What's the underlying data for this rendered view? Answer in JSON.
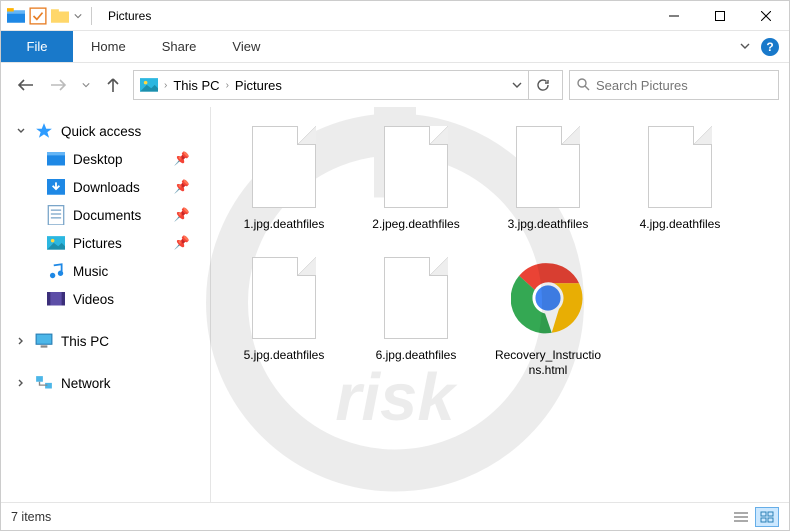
{
  "window": {
    "title": "Pictures"
  },
  "ribbon": {
    "file": "File",
    "tabs": [
      "Home",
      "Share",
      "View"
    ]
  },
  "address": {
    "crumbs": [
      "This PC",
      "Pictures"
    ]
  },
  "search": {
    "placeholder": "Search Pictures"
  },
  "sidebar": {
    "quick_access": "Quick access",
    "items": [
      {
        "label": "Desktop",
        "pinned": true,
        "icon": "desktop"
      },
      {
        "label": "Downloads",
        "pinned": true,
        "icon": "downloads"
      },
      {
        "label": "Documents",
        "pinned": true,
        "icon": "documents"
      },
      {
        "label": "Pictures",
        "pinned": true,
        "icon": "pictures"
      },
      {
        "label": "Music",
        "pinned": false,
        "icon": "music"
      },
      {
        "label": "Videos",
        "pinned": false,
        "icon": "videos"
      }
    ],
    "this_pc": "This PC",
    "network": "Network"
  },
  "files": [
    {
      "name": "1.jpg.deathfiles",
      "icon": "blank"
    },
    {
      "name": "2.jpeg.deathfiles",
      "icon": "blank"
    },
    {
      "name": "3.jpg.deathfiles",
      "icon": "blank"
    },
    {
      "name": "4.jpg.deathfiles",
      "icon": "blank"
    },
    {
      "name": "5.jpg.deathfiles",
      "icon": "blank"
    },
    {
      "name": "6.jpg.deathfiles",
      "icon": "blank"
    },
    {
      "name": "Recovery_Instructions.html",
      "icon": "chrome"
    }
  ],
  "status": {
    "count_label": "7 items"
  }
}
